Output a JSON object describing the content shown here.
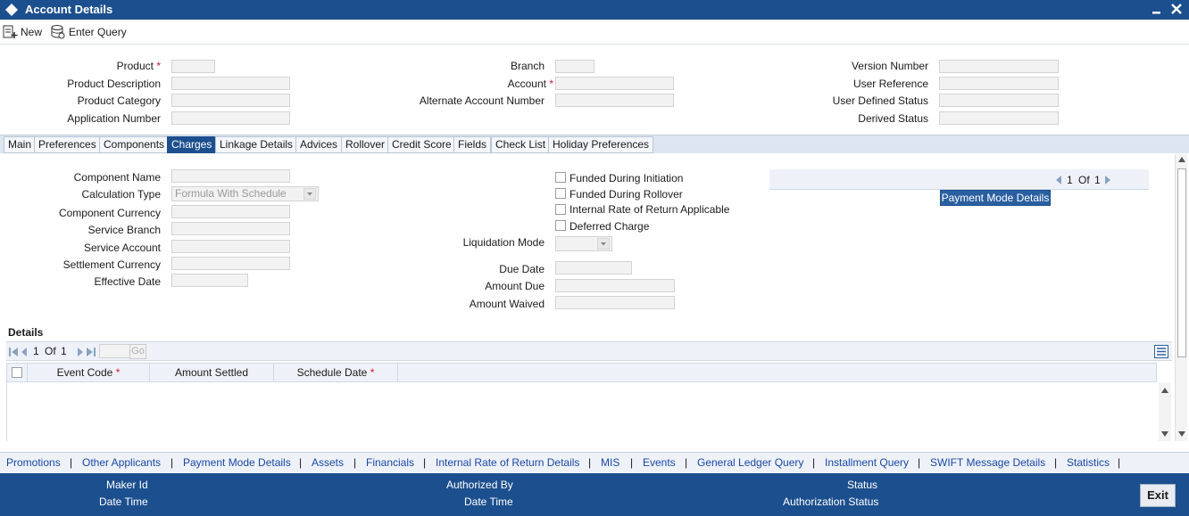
{
  "window": {
    "title": "Account Details"
  },
  "toolbar": {
    "new_label": "New",
    "enter_query_label": "Enter Query"
  },
  "header": {
    "product_label": "Product",
    "product_description_label": "Product Description",
    "product_category_label": "Product Category",
    "application_number_label": "Application Number",
    "branch_label": "Branch",
    "account_label": "Account",
    "alternate_account_label": "Alternate Account Number",
    "version_number_label": "Version Number",
    "user_reference_label": "User Reference",
    "user_defined_status_label": "User Defined Status",
    "derived_status_label": "Derived Status",
    "required_mark": "*"
  },
  "tabs": [
    "Main",
    "Preferences",
    "Components",
    "Charges",
    "Linkage Details",
    "Advices",
    "Rollover",
    "Credit Score",
    "Fields",
    "Check List",
    "Holiday Preferences"
  ],
  "active_tab": "Charges",
  "charges": {
    "component_name_label": "Component Name",
    "calculation_type_label": "Calculation Type",
    "calculation_type_value": "Formula With Schedule",
    "component_currency_label": "Component Currency",
    "service_branch_label": "Service Branch",
    "service_account_label": "Service Account",
    "settlement_currency_label": "Settlement Currency",
    "effective_date_label": "Effective Date",
    "funded_initiation_label": "Funded During Initiation",
    "funded_rollover_label": "Funded During Rollover",
    "irr_applicable_label": "Internal Rate of Return Applicable",
    "deferred_charge_label": "Deferred Charge",
    "liquidation_mode_label": "Liquidation Mode",
    "due_date_label": "Due Date",
    "amount_due_label": "Amount Due",
    "amount_waived_label": "Amount Waived",
    "pager_current": "1",
    "pager_of": "Of",
    "pager_total": "1",
    "payment_mode_button": "Payment Mode Details"
  },
  "details": {
    "title": "Details",
    "pager_current": "1",
    "pager_of": "Of",
    "pager_total": "1",
    "go_label": "Go",
    "columns": [
      "Event Code",
      "Amount Settled",
      "Schedule Date"
    ]
  },
  "bottom_links": [
    "Promotions",
    "Other Applicants",
    "Payment Mode Details",
    "Assets",
    "Financials",
    "Internal Rate of Return Details",
    "MIS",
    "Events",
    "General Ledger Query",
    "Installment Query",
    "SWIFT Message Details",
    "Statistics"
  ],
  "link_separator": "|",
  "footer": {
    "maker_id_label": "Maker Id",
    "date_time_label": "Date Time",
    "authorized_by_label": "Authorized By",
    "date_time_label_2": "Date Time",
    "status_label": "Status",
    "authorization_status_label": "Authorization Status",
    "exit_label": "Exit"
  },
  "colors": {
    "brand": "#1c4f8e",
    "link": "#1b47a6",
    "required": "#d0142e"
  }
}
